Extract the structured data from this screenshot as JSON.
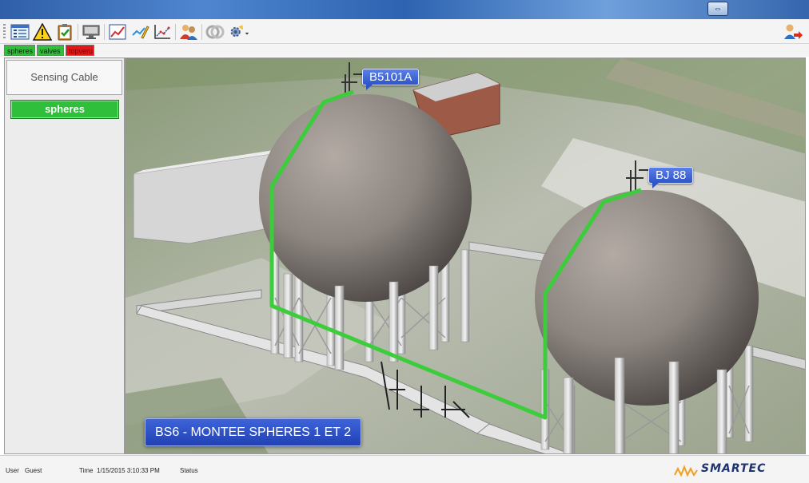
{
  "window": {
    "restore_label": "⇔"
  },
  "toolbar": {
    "buttons": [
      {
        "icon": "list-view-icon"
      },
      {
        "icon": "warning-icon"
      },
      {
        "icon": "clipboard-check-icon"
      },
      {
        "icon": "monitor-icon"
      },
      {
        "icon": "line-chart-icon"
      },
      {
        "icon": "pen-chart-icon"
      },
      {
        "icon": "scatter-chart-icon"
      },
      {
        "icon": "users-icon"
      },
      {
        "icon": "network-disabled-icon"
      },
      {
        "icon": "settings-dropdown-icon"
      }
    ],
    "logout_icon": "logout-user-icon"
  },
  "tabs": [
    {
      "label": "spheres",
      "color": "#2fbf3a"
    },
    {
      "label": "valves",
      "color": "#2fbf3a"
    },
    {
      "label": "topveru",
      "color": "#e01818"
    }
  ],
  "left_panel": {
    "header": "Sensing Cable",
    "button": "spheres",
    "button_color": "#2fbf3a"
  },
  "scene": {
    "callouts": [
      "B5101A",
      "BJ 88"
    ],
    "title": "BS6 - MONTEE SPHERES 1 ET 2",
    "cable_color": "#3ccc3c"
  },
  "status": {
    "user_label": "User",
    "user_value": "Guest",
    "time_label": "Time",
    "time_value": "1/15/2015 3:10:33 PM",
    "status_label": "Status"
  },
  "logo": {
    "text": "SMARTEC"
  }
}
